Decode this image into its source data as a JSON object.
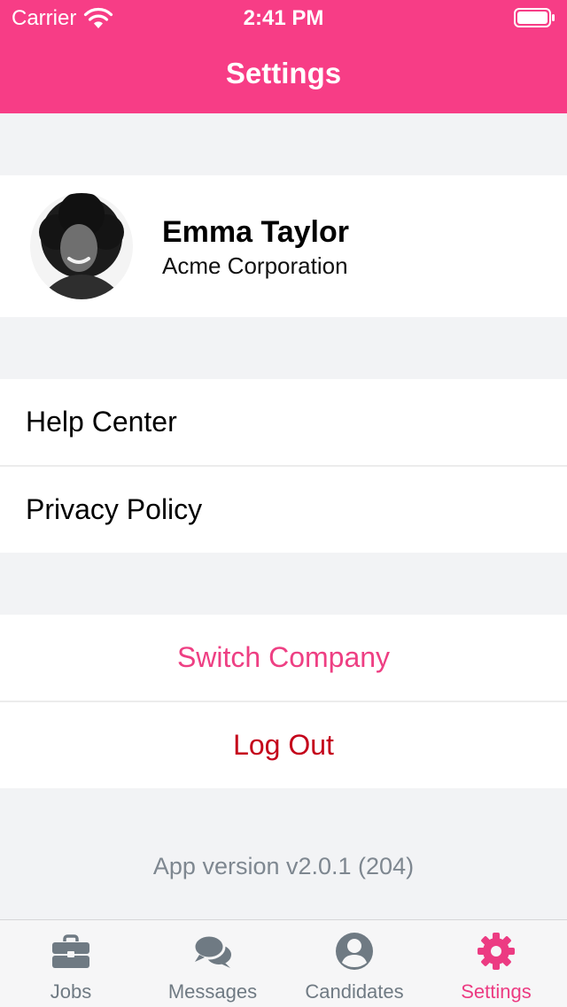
{
  "status_bar": {
    "carrier": "Carrier",
    "time": "2:41 PM"
  },
  "header": {
    "title": "Settings"
  },
  "profile": {
    "name": "Emma Taylor",
    "company": "Acme Corporation"
  },
  "menu": {
    "help_center": "Help Center",
    "privacy_policy": "Privacy Policy"
  },
  "actions": {
    "switch_company": "Switch Company",
    "log_out": "Log Out"
  },
  "footer": {
    "version": "App version v2.0.1 (204)"
  },
  "tab_bar": {
    "active": "Settings",
    "tabs": [
      {
        "label": "Jobs",
        "icon": "briefcase-icon"
      },
      {
        "label": "Messages",
        "icon": "chat-bubbles-icon"
      },
      {
        "label": "Candidates",
        "icon": "user-circle-icon"
      },
      {
        "label": "Settings",
        "icon": "gear-icon"
      }
    ]
  },
  "colors": {
    "brand_pink": "#f73d86",
    "switch_company": "#ee3f83",
    "log_out": "#c4001a",
    "tab_inactive": "#6f7a83"
  }
}
